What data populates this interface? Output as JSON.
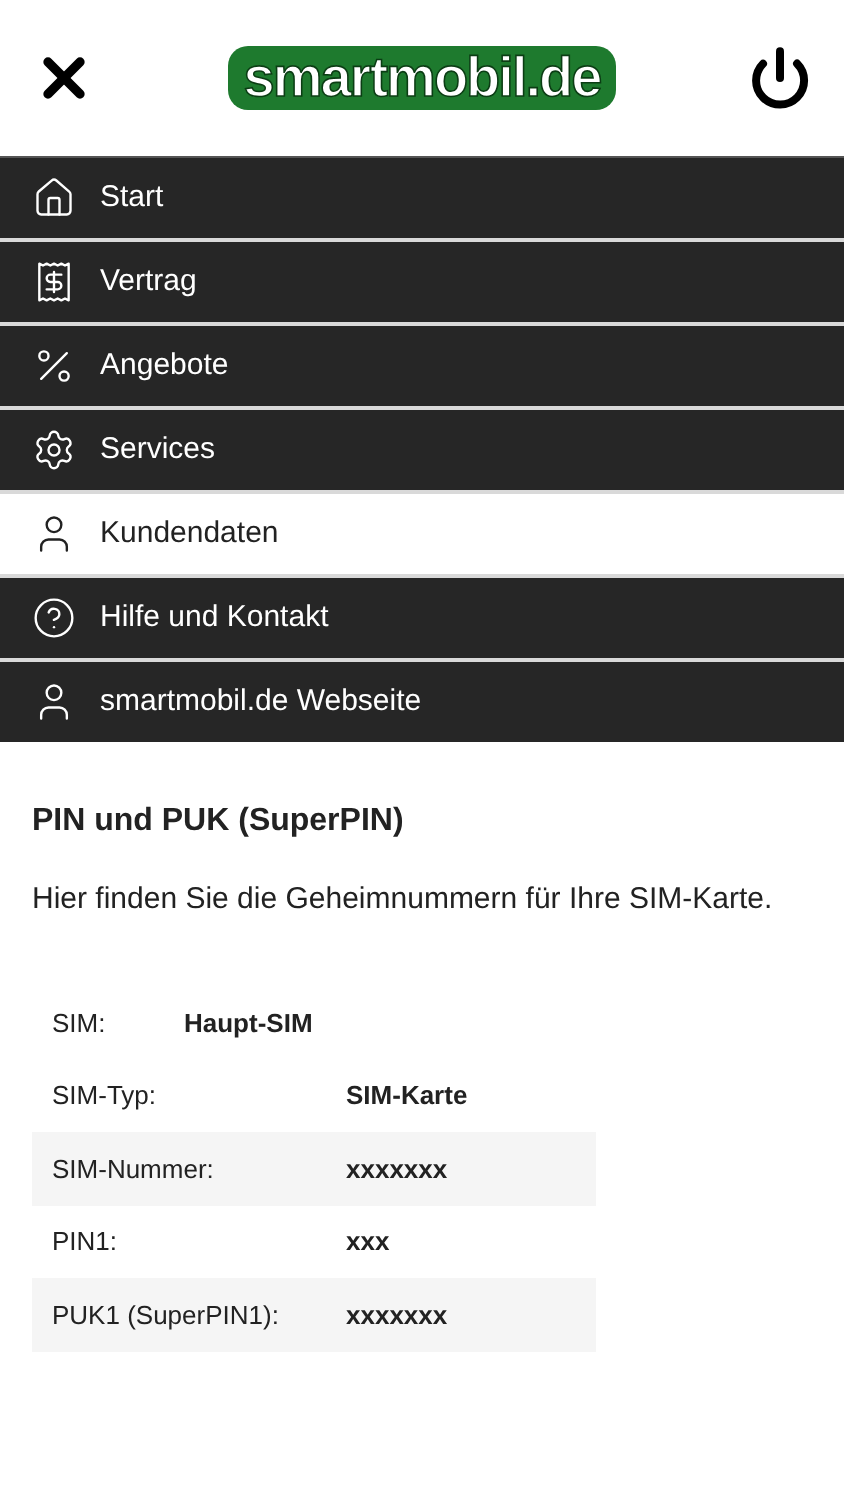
{
  "header": {
    "logo": "smartmobil.de"
  },
  "menu": [
    {
      "label": "Start",
      "kind": "home",
      "selected": false
    },
    {
      "label": "Vertrag",
      "kind": "contract",
      "selected": false
    },
    {
      "label": "Angebote",
      "kind": "offers",
      "selected": false
    },
    {
      "label": "Services",
      "kind": "services",
      "selected": false
    },
    {
      "label": "Kundendaten",
      "kind": "account",
      "selected": true
    },
    {
      "label": "Hilfe und Kontakt",
      "kind": "help",
      "selected": false
    },
    {
      "label": "smartmobil.de Webseite",
      "kind": "account",
      "selected": false
    }
  ],
  "content": {
    "title": "PIN und PUK (SuperPIN)",
    "description": "Hier finden Sie die Geheimnummern für Ihre SIM-Karte.",
    "sim": {
      "label": "SIM:",
      "value": "Haupt-SIM"
    },
    "table": [
      {
        "label": "SIM-Typ:",
        "value": "SIM-Karte"
      },
      {
        "label": "SIM-Nummer:",
        "value": "xxxxxxx"
      },
      {
        "label": "PIN1:",
        "value": "xxx"
      },
      {
        "label": "PUK1 (SuperPIN1):",
        "value": "xxxxxxx"
      }
    ]
  }
}
